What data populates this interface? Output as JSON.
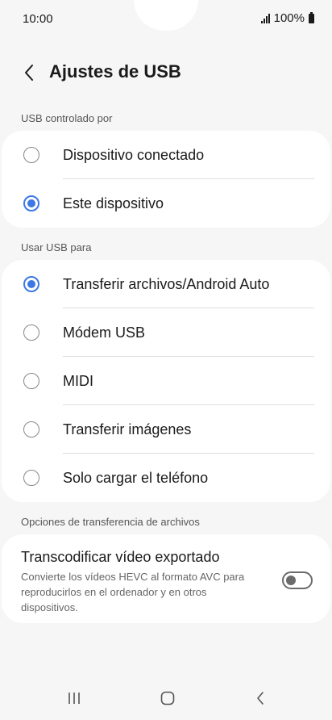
{
  "status": {
    "time": "10:00",
    "battery": "100%"
  },
  "header": {
    "title": "Ajustes de USB"
  },
  "usb_controlled_by": {
    "label": "USB controlado por",
    "options": [
      {
        "label": "Dispositivo conectado",
        "selected": false
      },
      {
        "label": "Este dispositivo",
        "selected": true
      }
    ]
  },
  "usb_use_for": {
    "label": "Usar USB para",
    "options": [
      {
        "label": "Transferir archivos/Android Auto",
        "selected": true
      },
      {
        "label": "Módem USB",
        "selected": false
      },
      {
        "label": "MIDI",
        "selected": false
      },
      {
        "label": "Transferir imágenes",
        "selected": false
      },
      {
        "label": "Solo cargar el teléfono",
        "selected": false
      }
    ]
  },
  "transfer_options": {
    "label": "Opciones de transferencia de archivos",
    "transcode": {
      "title": "Transcodificar vídeo exportado",
      "description": "Convierte los vídeos HEVC al formato AVC para reproducirlos en el ordenador y en otros dispositivos.",
      "enabled": false
    }
  },
  "colors": {
    "accent": "#3e78e5",
    "background": "#f6f6f6",
    "card": "#ffffff"
  }
}
